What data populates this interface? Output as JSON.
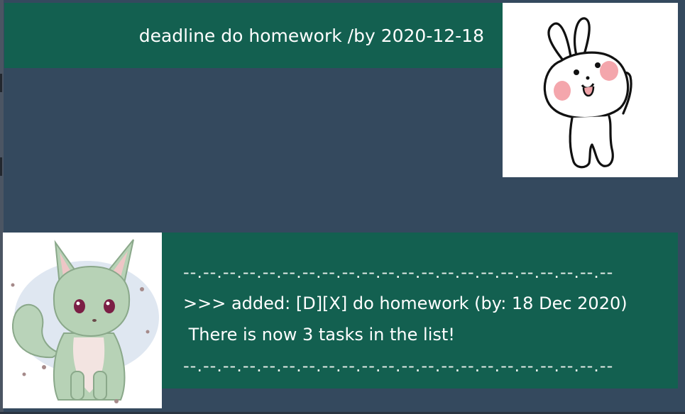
{
  "chat": {
    "user_message": "deadline do homework /by 2020-12-18",
    "bot_message": {
      "divider_top": "--.--.--.--.--.--.--.--.--.--.--.--.--.--.--.--.--.--.--.--.--.--",
      "line1": ">>> added: [D][X] do homework (by: 18 Dec 2020)",
      "line2": " There is now 3 tasks in the list!",
      "divider_bottom": "--.--.--.--.--.--.--.--.--.--.--.--.--.--.--.--.--.--.--.--.--.--"
    }
  },
  "avatars": {
    "user": "bunny-avatar",
    "bot": "green-fox-avatar"
  },
  "colors": {
    "background": "#34495e",
    "bubble": "#136050",
    "text": "#ffffff"
  }
}
